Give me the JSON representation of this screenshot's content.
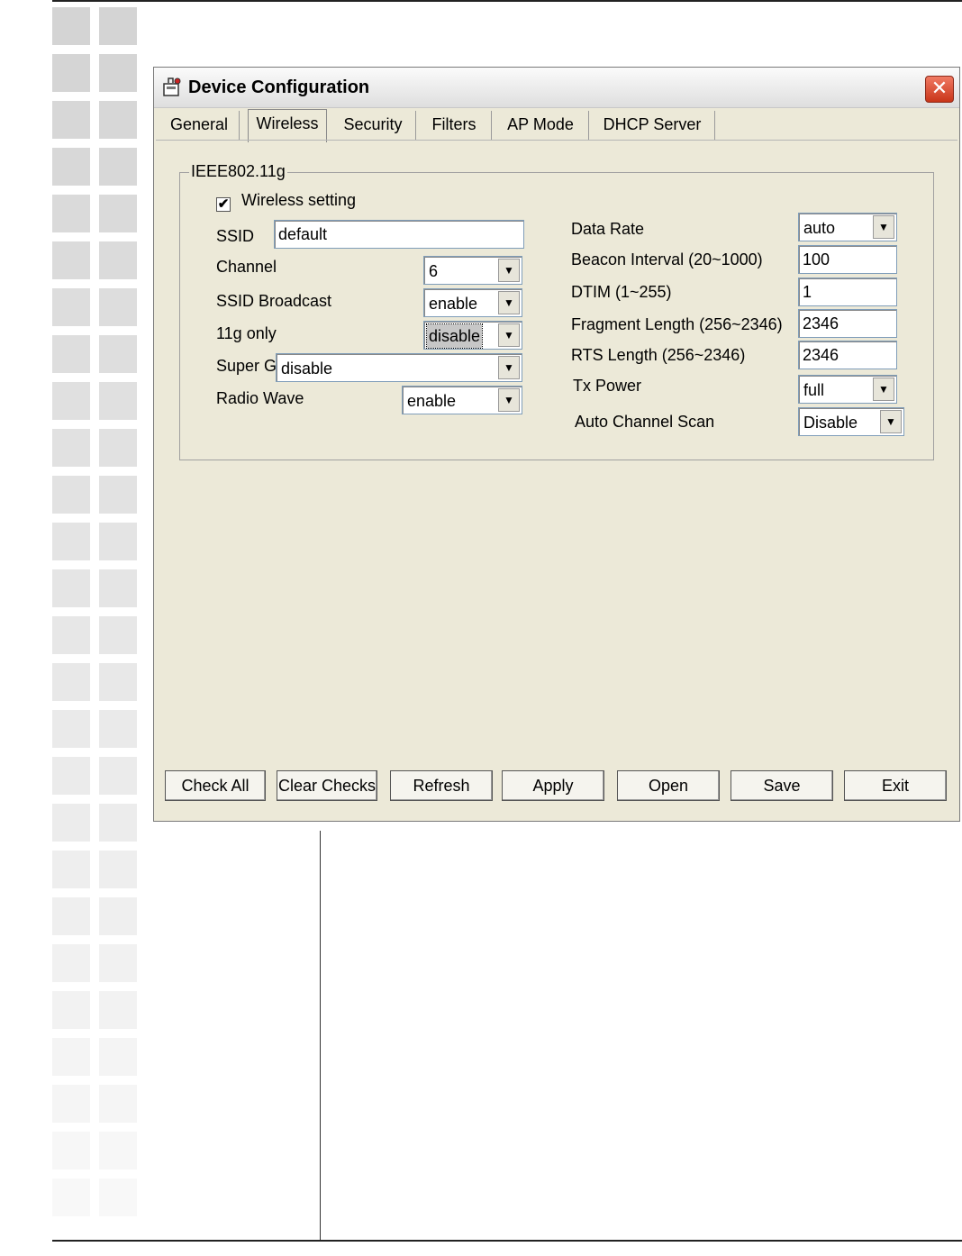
{
  "window": {
    "title": "Device Configuration",
    "close_glyph": "✕",
    "title_icon": "device-config-icon"
  },
  "tabs": [
    {
      "label": "General",
      "active": false
    },
    {
      "label": "Wireless",
      "active": true
    },
    {
      "label": "Security",
      "active": false
    },
    {
      "label": "Filters",
      "active": false
    },
    {
      "label": "AP Mode",
      "active": false
    },
    {
      "label": "DHCP Server",
      "active": false
    }
  ],
  "group": {
    "legend": "IEEE802.11g",
    "wireless_setting": {
      "label": "Wireless setting",
      "checked": true,
      "mark": "✔"
    }
  },
  "left": {
    "ssid": {
      "label": "SSID",
      "value": "default"
    },
    "channel": {
      "label": "Channel",
      "value": "6"
    },
    "ssid_broadcast": {
      "label": "SSID Broadcast",
      "value": "enable"
    },
    "g_only": {
      "label": "11g only",
      "value": "disable"
    },
    "super_g": {
      "label": "Super G",
      "value": "disable"
    },
    "radio_wave": {
      "label": "Radio Wave",
      "value": "enable"
    }
  },
  "right": {
    "data_rate": {
      "label": "Data Rate",
      "value": "auto"
    },
    "beacon": {
      "label": "Beacon Interval (20~1000)",
      "value": "100"
    },
    "dtim": {
      "label": "DTIM (1~255)",
      "value": "1"
    },
    "fragment": {
      "label": "Fragment Length (256~2346)",
      "value": "2346"
    },
    "rts": {
      "label": "RTS Length (256~2346)",
      "value": "2346"
    },
    "tx_power": {
      "label": "Tx Power",
      "value": "full"
    },
    "auto_channel": {
      "label": "Auto Channel Scan",
      "value": "Disable"
    }
  },
  "buttons": {
    "check_all": "Check All",
    "clear_checks": "Clear Checks",
    "refresh": "Refresh",
    "apply": "Apply",
    "open": "Open",
    "save": "Save",
    "exit": "Exit"
  },
  "arrow_glyph": "▼",
  "colors": {
    "window_bg": "#ece9d8",
    "close_button": "#d9472b",
    "square_dark": "#d6d6d6",
    "square_light": "#f2f2f2"
  }
}
